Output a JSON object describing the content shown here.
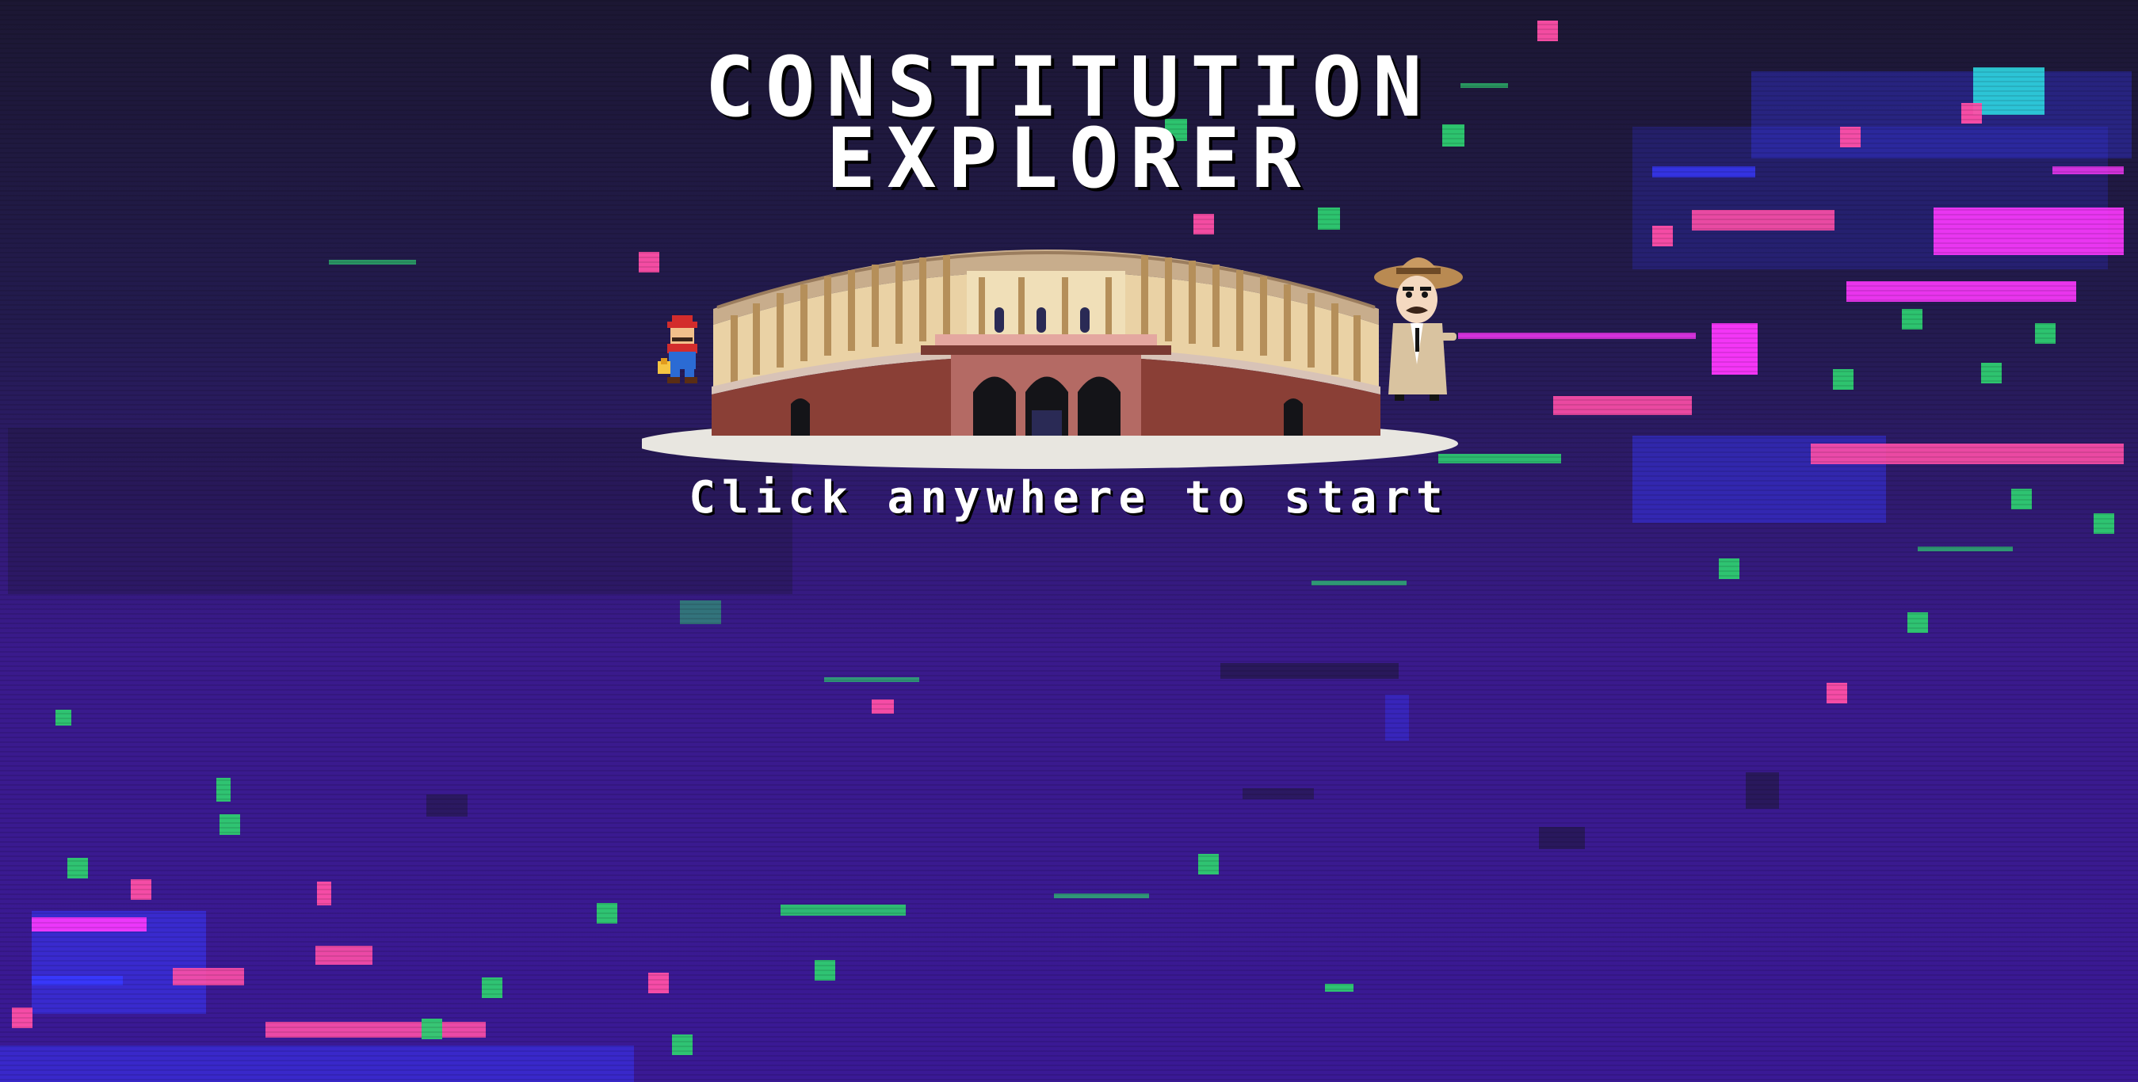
{
  "title": {
    "line1": "CONSTITUTION",
    "line2": "EXPLORER"
  },
  "prompt": "Click anywhere to start",
  "colors": {
    "background_top": "#1c1733",
    "background_bottom": "#3a1995",
    "glitch_pink": "#ff4fa8",
    "glitch_green": "#2ecc71",
    "glitch_blue": "#3838ff",
    "glitch_cyan": "#2ed6e0",
    "glitch_magenta": "#ff38ff",
    "title_text": "#ffffff"
  },
  "icons": {
    "building": "parliament-building-icon",
    "left_character": "plumber-character-icon",
    "right_character": "detective-character-icon"
  }
}
